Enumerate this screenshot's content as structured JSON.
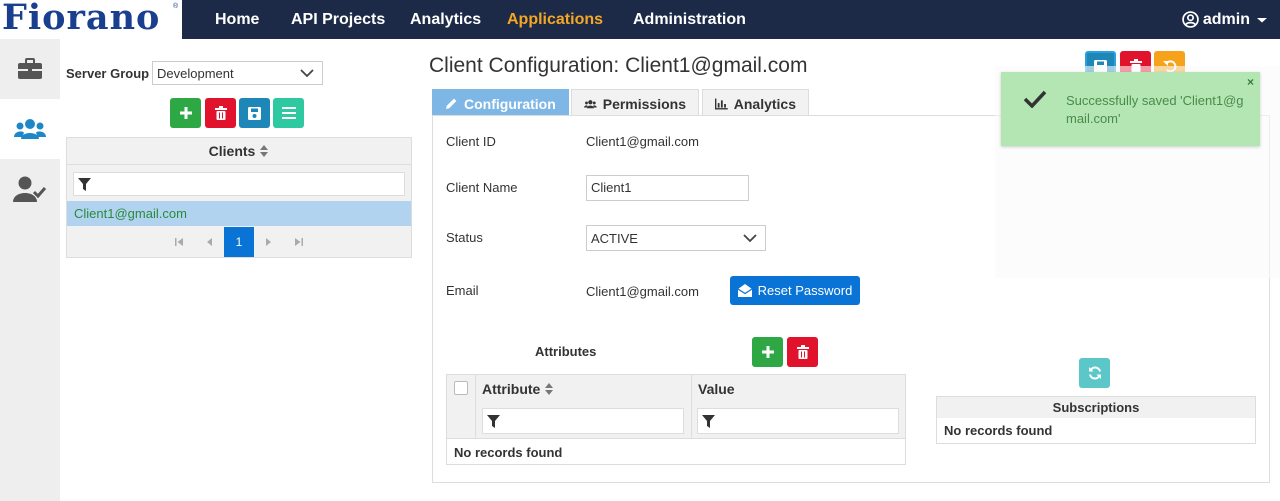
{
  "app": {
    "logo_text": "Fiorano",
    "logo_reg": "®"
  },
  "nav": {
    "items": [
      {
        "label": "Home"
      },
      {
        "label": "API Projects"
      },
      {
        "label": "Analytics"
      },
      {
        "label": "Applications"
      },
      {
        "label": "Administration"
      }
    ],
    "active": "Applications",
    "user": "admin"
  },
  "sidebar": {
    "tabs": [
      {
        "icon": "briefcase-icon"
      },
      {
        "icon": "users-icon"
      },
      {
        "icon": "user-check-icon"
      }
    ]
  },
  "left": {
    "server_group_label": "Server Group",
    "server_group_value": "Development",
    "clients_header": "Clients",
    "clients": [
      "Client1@gmail.com"
    ],
    "pager": {
      "current": "1"
    }
  },
  "main": {
    "title": "Client Configuration: Client1@gmail.com",
    "tabs": [
      {
        "label": "Configuration"
      },
      {
        "label": "Permissions"
      },
      {
        "label": "Analytics"
      }
    ],
    "fields": {
      "client_id_label": "Client ID",
      "client_id_value": "Client1@gmail.com",
      "client_name_label": "Client Name",
      "client_name_value": "Client1",
      "status_label": "Status",
      "status_value": "ACTIVE",
      "email_label": "Email",
      "email_value": "Client1@gmail.com",
      "reset_password_label": "Reset Password"
    },
    "attributes": {
      "title": "Attributes",
      "col_attribute": "Attribute",
      "col_value": "Value",
      "empty": "No records found"
    },
    "subscriptions": {
      "title": "Subscriptions",
      "empty": "No records found"
    }
  },
  "toast": {
    "message": "Successfully saved 'Client1@gmail.com'",
    "close": "×"
  },
  "colors": {
    "nav_bg": "#1c2a48",
    "nav_active": "#f5a623",
    "green": "#2ea844",
    "red": "#e0122c",
    "blue": "#1e87b8",
    "primary": "#0a74d6",
    "toast_bg": "#b4e6b4"
  }
}
